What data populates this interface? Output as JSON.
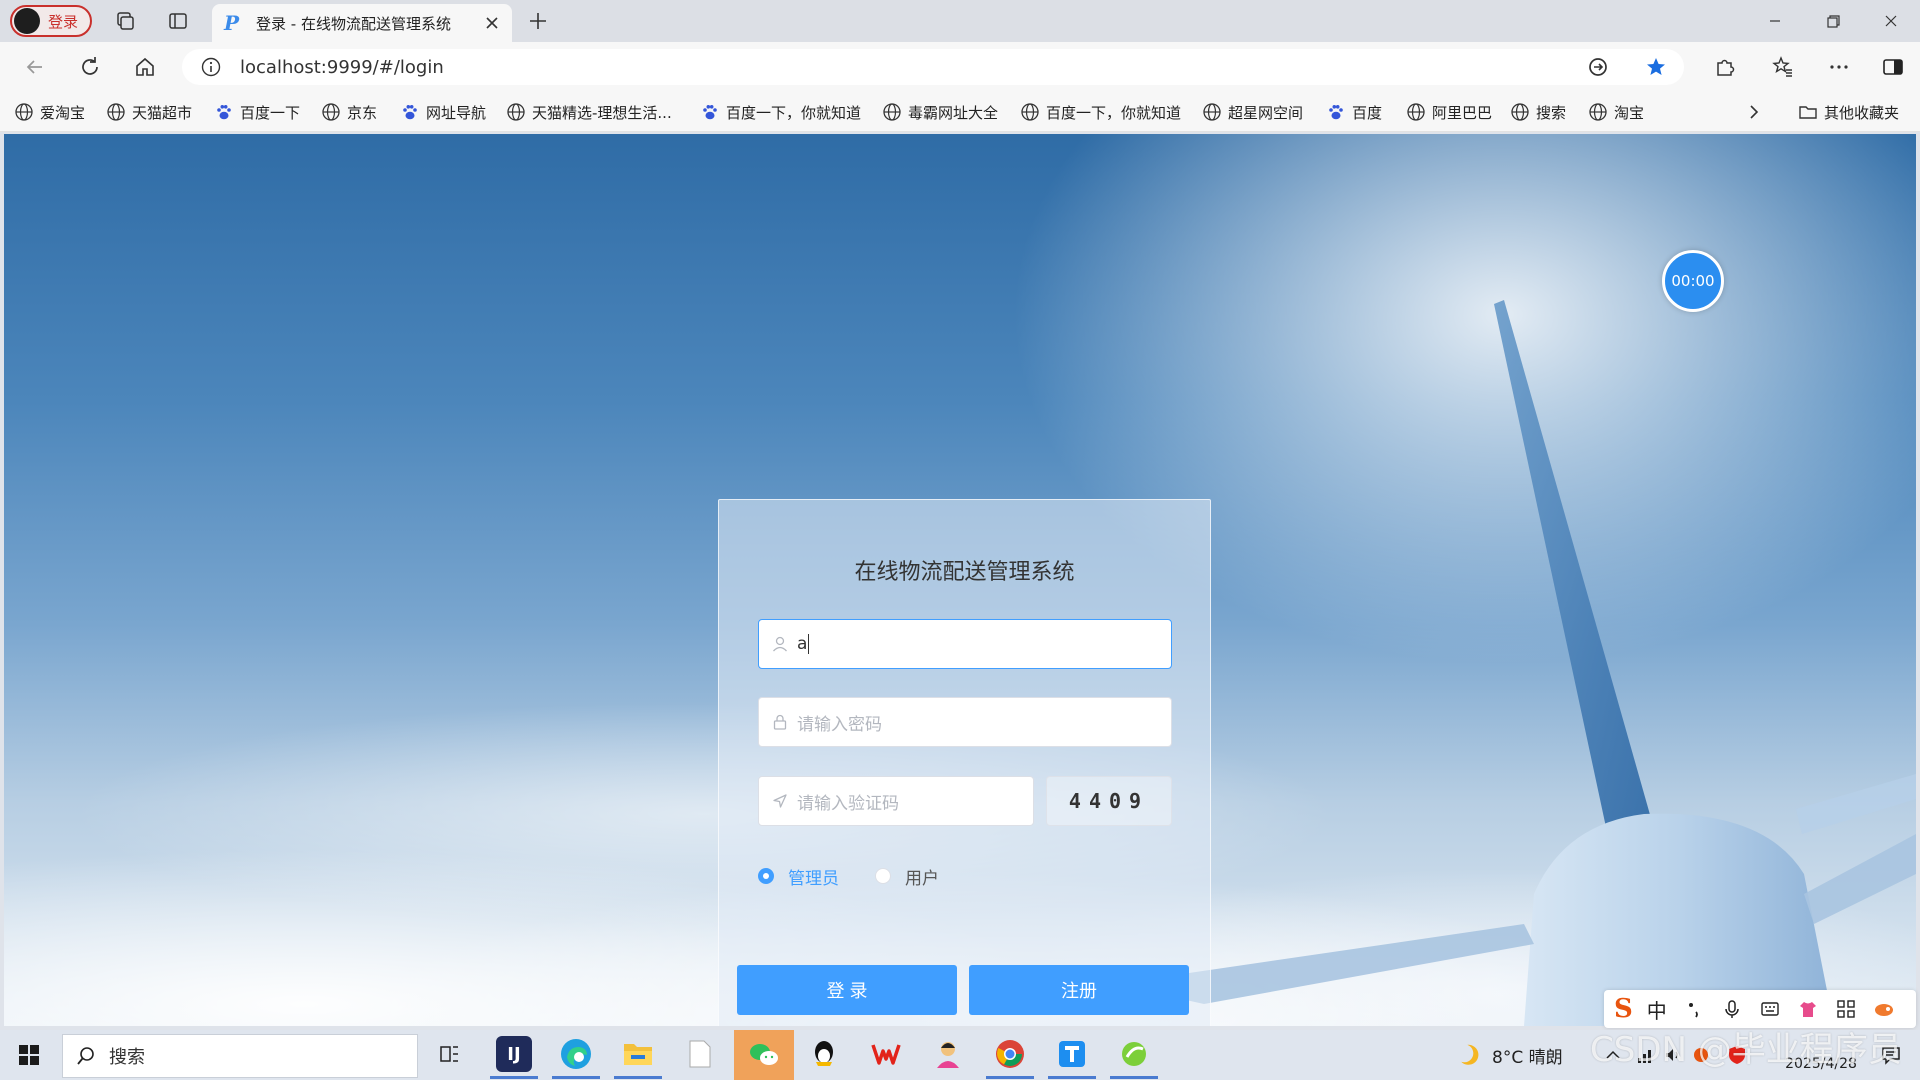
{
  "browser": {
    "profile_label": "登录",
    "tab_title": "登录 - 在线物流配送管理系统",
    "url": "localhost:9999/#/login"
  },
  "bookmarks": [
    {
      "label": "爱淘宝",
      "icon": "globe-icon"
    },
    {
      "label": "天猫超市",
      "icon": "globe-icon"
    },
    {
      "label": "百度一下",
      "icon": "baidu-paw-icon"
    },
    {
      "label": "京东",
      "icon": "globe-icon"
    },
    {
      "label": "网址导航",
      "icon": "baidu-paw-icon"
    },
    {
      "label": "天猫精选-理想生活...",
      "icon": "globe-icon"
    },
    {
      "label": "百度一下，你就知道",
      "icon": "baidu-paw-icon"
    },
    {
      "label": "毒霸网址大全",
      "icon": "globe-icon"
    },
    {
      "label": "百度一下，你就知道",
      "icon": "globe-icon"
    },
    {
      "label": "超星网空间",
      "icon": "globe-icon"
    },
    {
      "label": "百度",
      "icon": "baidu-paw-icon"
    },
    {
      "label": "阿里巴巴",
      "icon": "globe-icon"
    },
    {
      "label": "搜索",
      "icon": "globe-icon"
    },
    {
      "label": "淘宝",
      "icon": "globe-icon"
    }
  ],
  "bookmarks_other": "其他收藏夹",
  "timer": "00:00",
  "login": {
    "title": "在线物流配送管理系统",
    "username_value": "a",
    "password_placeholder": "请输入密码",
    "captcha_placeholder": "请输入验证码",
    "captcha_code": "4409",
    "roles": [
      {
        "label": "管理员",
        "checked": true
      },
      {
        "label": "用户",
        "checked": false
      }
    ],
    "login_button": "登 录",
    "register_button": "注册"
  },
  "ime": {
    "mode": "中"
  },
  "taskbar": {
    "search_label": "搜索",
    "weather": "8°C 晴朗",
    "date": "2025/4/28"
  },
  "watermark": "CSDN @毕业程序员",
  "colors": {
    "accent": "#409eff",
    "timer": "#2b8ef0"
  }
}
